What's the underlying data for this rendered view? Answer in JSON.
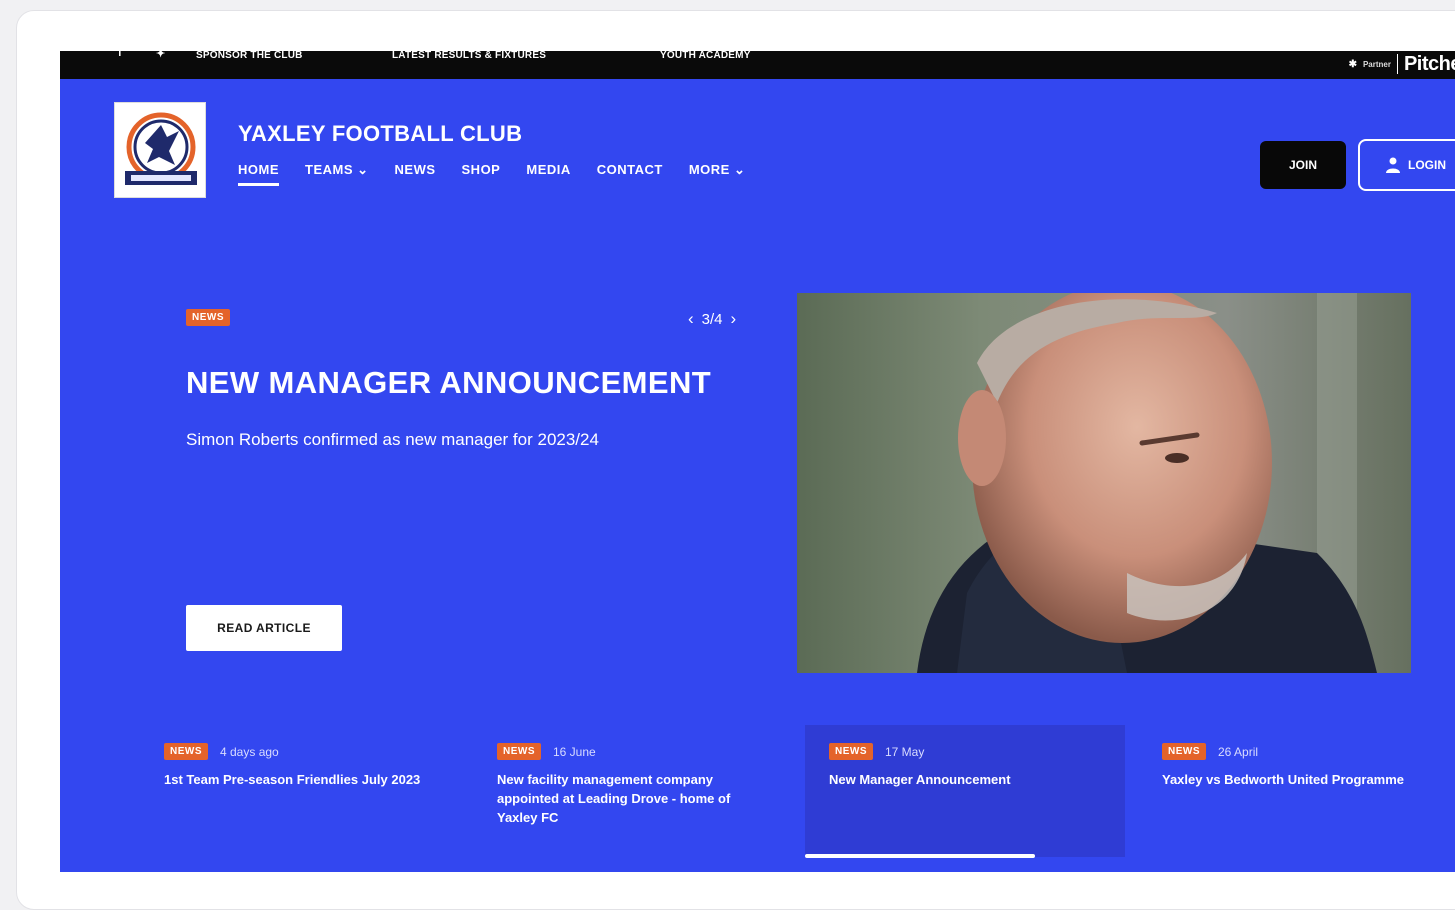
{
  "topbar": {
    "links": [
      "SPONSOR THE CLUB",
      "LATEST RESULTS & FIXTURES",
      "YOUTH ACADEMY"
    ],
    "partner_label": "Partner",
    "partner_brand": "Pitchero"
  },
  "header": {
    "club_name": "YAXLEY FOOTBALL CLUB",
    "nav": [
      "HOME",
      "TEAMS ⌄",
      "NEWS",
      "SHOP",
      "MEDIA",
      "CONTACT",
      "MORE ⌄"
    ],
    "join_label": "JOIN",
    "login_label": "LOGIN"
  },
  "hero": {
    "badge": "NEWS",
    "pager_prev": "‹",
    "pager_text": "3/4",
    "pager_next": "›",
    "title": "NEW MANAGER ANNOUNCEMENT",
    "subtitle": "Simon Roberts confirmed as new manager for 2023/24",
    "cta": "READ ARTICLE"
  },
  "news_cards": [
    {
      "badge": "NEWS",
      "date": "4 days ago",
      "title": "1st Team Pre-season Friendlies July 2023"
    },
    {
      "badge": "NEWS",
      "date": "16 June",
      "title": "New facility management company appointed at Leading Drove - home of Yaxley FC"
    },
    {
      "badge": "NEWS",
      "date": "17 May",
      "title": "New Manager Announcement"
    },
    {
      "badge": "NEWS",
      "date": "26 April",
      "title": "Yaxley vs Bedworth United Programme"
    }
  ],
  "colors": {
    "brand_blue": "#3347f0",
    "badge_orange": "#e4632a",
    "topbar_black": "#0a0a0a"
  },
  "slider_progress": 0.72
}
